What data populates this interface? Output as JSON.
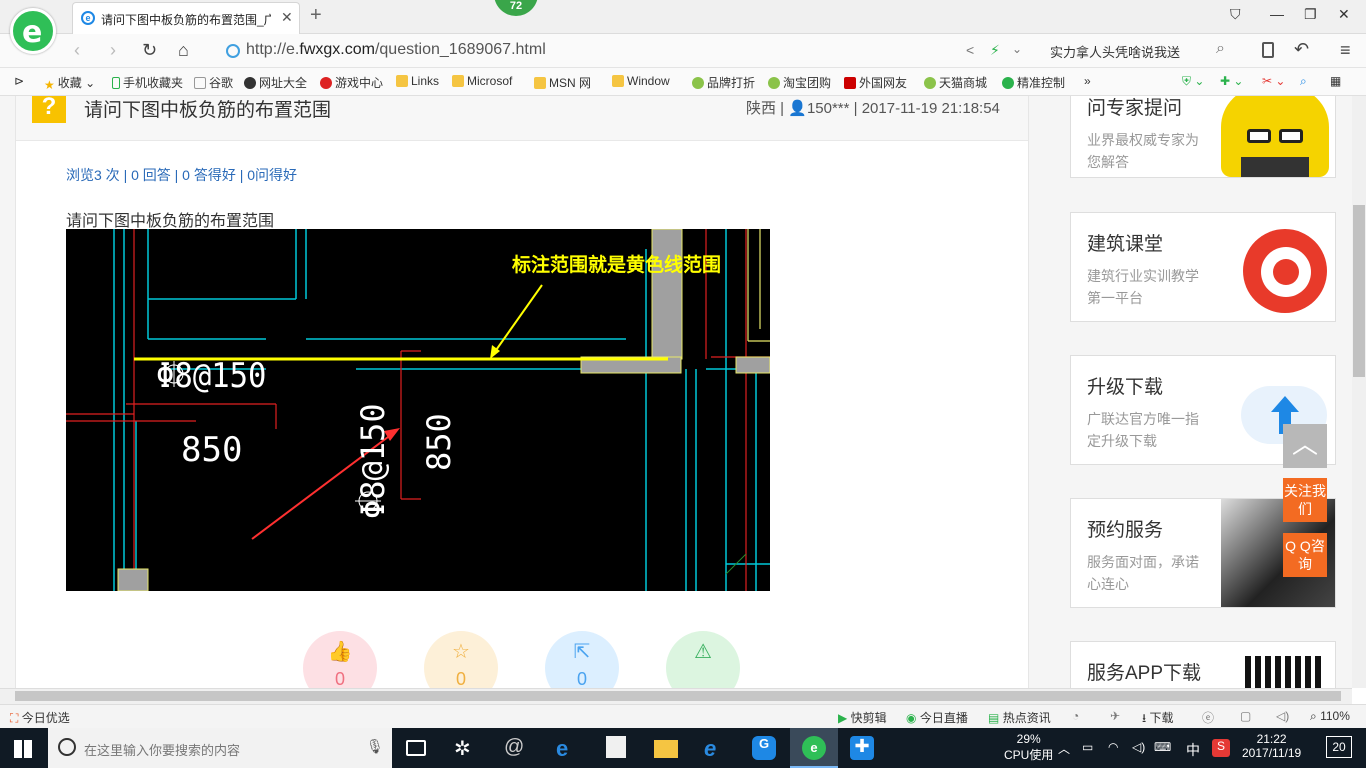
{
  "browser": {
    "tab_title": "请问下图中板负筋的布置范围_广",
    "badge_count": "72",
    "url_prefix": "http://e.",
    "url_domain": "fwxgx.com",
    "url_path": "/question_1689067.html",
    "search_text": "实力拿人头凭啥说我送"
  },
  "bookmarks": [
    "收藏",
    "手机收藏夹",
    "谷歌",
    "网址大全",
    "游戏中心",
    "Links",
    "Microsof",
    "MSN 网",
    "Window",
    "品牌打折",
    "淘宝团购",
    "外国网友",
    "天猫商城",
    "精准控制"
  ],
  "question": {
    "title": "请问下图中板负筋的布置范围",
    "location": "陕西",
    "user": "150***",
    "datetime": "2017-11-19 21:18:54",
    "stats": "浏览3 次 | 0 回答 | 0 答得好 | 0问得好",
    "body": "请问下图中板负筋的布置范围",
    "cad_annotation": "标注范围就是黄色线范围",
    "cad_rebar_h": "Φ8@150",
    "cad_rebar_v": "Φ8@150",
    "cad_dim_left": "850",
    "cad_dim_right": "850",
    "action_counts": [
      "0",
      "0",
      "0"
    ]
  },
  "sidebar": [
    {
      "title": "问专家提问",
      "sub": "业界最权威专家为您解答",
      "icon": "expert-mascot-icon"
    },
    {
      "title": "建筑课堂",
      "sub": "建筑行业实训教学第一平台",
      "icon": "red-swirl-logo-icon"
    },
    {
      "title": "升级下载",
      "sub": "广联达官方唯一指定升级下载",
      "icon": "cloud-upload-icon"
    },
    {
      "title": "预约服务",
      "sub": "服务面对面，承诺心连心",
      "icon": "service-person-icon"
    },
    {
      "title": "服务APP下载",
      "sub": "",
      "icon": "qr-code-icon"
    }
  ],
  "float_buttons": {
    "follow": "关注我们",
    "qq": "Q Q咨询"
  },
  "statusbar": {
    "left": "今日优选",
    "items": [
      "快剪辑",
      "今日直播",
      "热点资讯",
      "下载"
    ],
    "zoom": "110%"
  },
  "taskbar": {
    "search_placeholder": "在这里输入你要搜索的内容",
    "cpu_percent": "29%",
    "cpu_label": "CPU使用",
    "ime": "中",
    "time": "21:22",
    "date": "2017/11/19",
    "notifications": "20"
  },
  "colors": {
    "brand_green": "#2fbf57",
    "link_blue": "#2a6ab8",
    "accent_orange": "#f36b22",
    "cad_yellow": "#ffff00"
  }
}
